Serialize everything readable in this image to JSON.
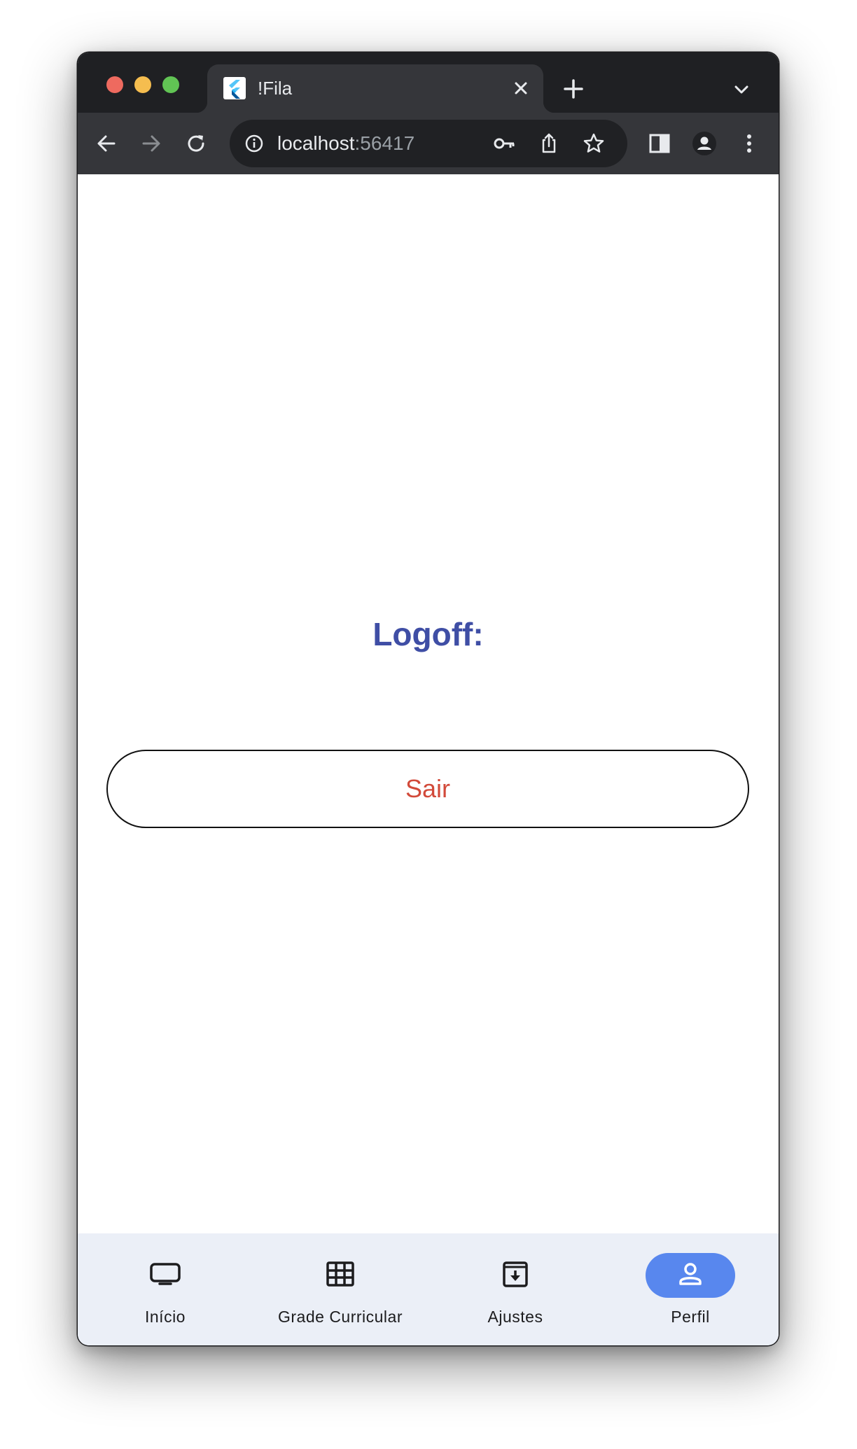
{
  "browser": {
    "tab": {
      "title": "!Fila"
    },
    "address_bar": {
      "host": "localhost",
      "port": ":56417"
    }
  },
  "page": {
    "heading": "Logoff:",
    "logout_button_label": "Sair"
  },
  "bottom_nav": {
    "items": [
      {
        "label": "Início",
        "icon": "tv-icon",
        "active": false
      },
      {
        "label": "Grade Curricular",
        "icon": "grid-icon",
        "active": false
      },
      {
        "label": "Ajustes",
        "icon": "archive-icon",
        "active": false
      },
      {
        "label": "Perfil",
        "icon": "person-icon",
        "active": true
      }
    ]
  },
  "colors": {
    "heading": "#3f4ea5",
    "logout_text": "#d24a3a",
    "nav_background": "#ebeff7",
    "nav_active_pill": "#5887ee"
  }
}
